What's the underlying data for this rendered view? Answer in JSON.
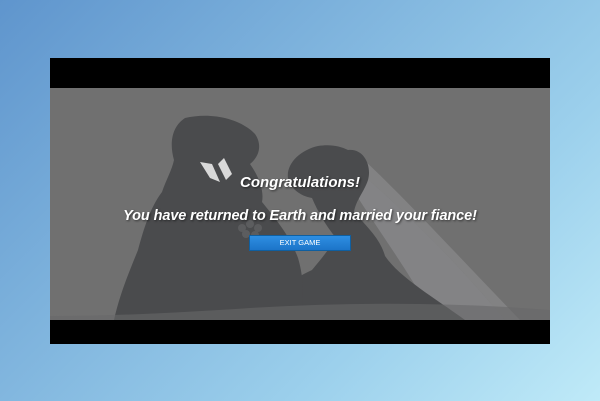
{
  "screen": {
    "title": "Congratulations!",
    "message": "You have returned to Earth and married your fiance!",
    "exit_button_label": "EXIT GAME"
  },
  "scene": {
    "illustration": "wedding-couple-silhouette",
    "background_color": "#707070",
    "silhouette_color": "#4a4b4d",
    "frame_color": "#000000"
  },
  "button_color": "#1f7fd6"
}
